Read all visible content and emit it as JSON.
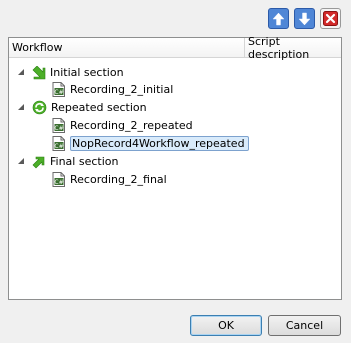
{
  "toolbar": {
    "up_icon": "arrow-up-icon",
    "down_icon": "arrow-down-icon",
    "delete_icon": "delete-x-icon"
  },
  "tree": {
    "columns": [
      "Workflow",
      "Script description"
    ],
    "sections": [
      {
        "label": "Initial section",
        "icon": "arrow-down-right-icon",
        "items": [
          "Recording_2_initial"
        ]
      },
      {
        "label": "Repeated section",
        "icon": "repeat-cycle-icon",
        "items": [
          "Recording_2_repeated",
          "NopRecord4Workflow_repeated"
        ]
      },
      {
        "label": "Final section",
        "icon": "arrow-up-right-icon",
        "items": [
          "Recording_2_final"
        ]
      }
    ],
    "selected_item": "NopRecord4Workflow_repeated",
    "item_icon": "csharp-script-icon"
  },
  "buttons": {
    "ok": "OK",
    "cancel": "Cancel"
  },
  "colors": {
    "section_icon_green": "#4caf28",
    "selection_bg": "#d9ebfb",
    "accent_blue": "#4f86d6",
    "delete_red": "#d22a2a"
  }
}
